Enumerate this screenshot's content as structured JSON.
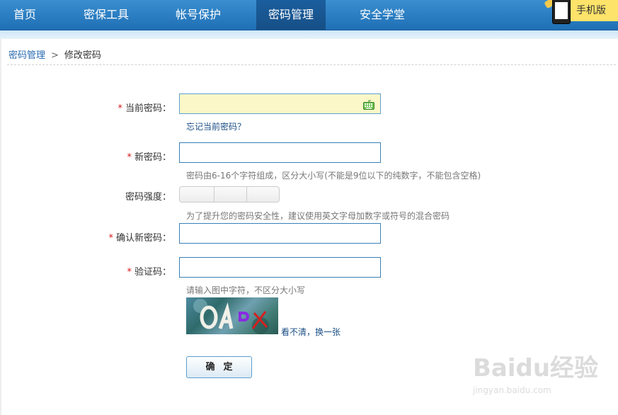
{
  "nav": {
    "items": [
      {
        "label": "首页"
      },
      {
        "label": "密保工具"
      },
      {
        "label": "帐号保护"
      },
      {
        "label": "密码管理"
      },
      {
        "label": "安全学堂"
      }
    ],
    "active_index": 3,
    "promo_text": "手机版"
  },
  "breadcrumb": {
    "parent": "密码管理",
    "separator": ">",
    "current": "修改密码"
  },
  "form": {
    "required_mark": "*",
    "current_password": {
      "label": "当前密码：",
      "value": ""
    },
    "forgot_link": "忘记当前密码？",
    "new_password": {
      "label": "新密码：",
      "value": ""
    },
    "new_password_hint": "密码由6-16个字符组成，区分大小写(不能是9位以下的纯数字，不能包含空格)",
    "strength_label": "密码强度：",
    "strength_hint": "为了提升您的密码安全性，建议使用英文字母加数字或符号的混合密码",
    "confirm_password": {
      "label": "确认新密码：",
      "value": ""
    },
    "captcha": {
      "label": "验证码：",
      "value": "",
      "hint": "请输入图中字符，不区分大小写",
      "refresh_link": "看不清，换一张"
    },
    "submit_label": "确定"
  },
  "watermark": {
    "brand": "Baidu经验",
    "url": "jingyan.baidu.com"
  },
  "colors": {
    "nav": "#2a7fc4",
    "nav_active": "#1b5e9e",
    "required": "#d41818",
    "link": "#1a4e85",
    "current_field_bg": "#fbf7c8"
  }
}
